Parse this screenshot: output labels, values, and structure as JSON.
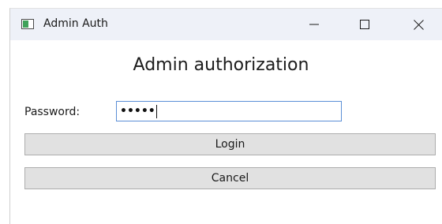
{
  "window": {
    "title": "Admin Auth",
    "icon": "app-window-icon",
    "controls": {
      "minimize": "minimize-icon",
      "maximize": "maximize-icon",
      "close": "close-icon"
    }
  },
  "form": {
    "heading": "Admin authorization",
    "password_label": "Password:",
    "password_masked": "•••••",
    "login_label": "Login",
    "cancel_label": "Cancel"
  },
  "colors": {
    "titlebar_bg": "#eef1f8",
    "input_border_focus": "#5b8fd6",
    "button_bg": "#e1e1e1",
    "button_border": "#adadad"
  }
}
